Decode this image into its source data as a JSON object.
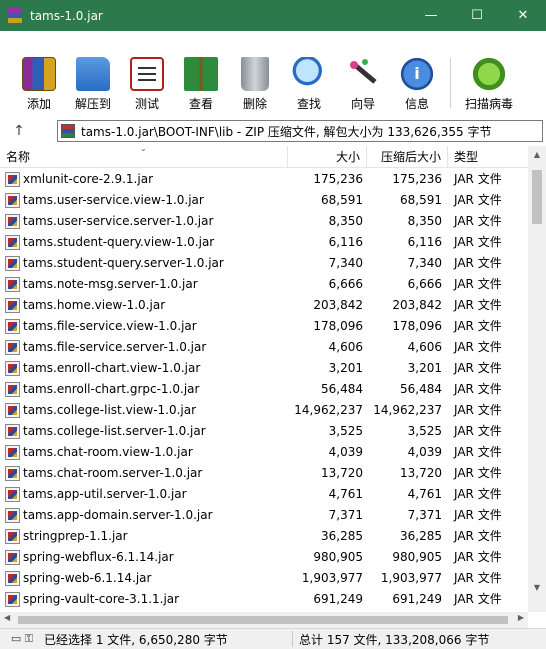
{
  "window": {
    "title": "tams-1.0.jar",
    "minimize": "—",
    "maximize": "☐",
    "close": "✕"
  },
  "toolbar": [
    {
      "label": "添加",
      "icon": "add-archive-icon"
    },
    {
      "label": "解压到",
      "icon": "extract-to-icon"
    },
    {
      "label": "测试",
      "icon": "test-icon"
    },
    {
      "label": "查看",
      "icon": "view-icon"
    },
    {
      "label": "删除",
      "icon": "delete-icon"
    },
    {
      "label": "查找",
      "icon": "find-icon"
    },
    {
      "label": "向导",
      "icon": "wizard-icon"
    },
    {
      "label": "信息",
      "icon": "info-icon"
    },
    {
      "label": "扫描病毒",
      "icon": "virus-scan-icon"
    }
  ],
  "address": {
    "up": "↑",
    "path": "tams-1.0.jar\\BOOT-INF\\lib - ZIP 压缩文件, 解包大小为 133,626,355 字节"
  },
  "columns": {
    "name": "名称",
    "size": "大小",
    "packed": "压缩后大小",
    "type": "类型"
  },
  "files": [
    {
      "name": "xmlunit-core-2.9.1.jar",
      "size": "175,236",
      "packed": "175,236",
      "type": "JAR 文件"
    },
    {
      "name": "tams.user-service.view-1.0.jar",
      "size": "68,591",
      "packed": "68,591",
      "type": "JAR 文件"
    },
    {
      "name": "tams.user-service.server-1.0.jar",
      "size": "8,350",
      "packed": "8,350",
      "type": "JAR 文件"
    },
    {
      "name": "tams.student-query.view-1.0.jar",
      "size": "6,116",
      "packed": "6,116",
      "type": "JAR 文件"
    },
    {
      "name": "tams.student-query.server-1.0.jar",
      "size": "7,340",
      "packed": "7,340",
      "type": "JAR 文件"
    },
    {
      "name": "tams.note-msg.server-1.0.jar",
      "size": "6,666",
      "packed": "6,666",
      "type": "JAR 文件"
    },
    {
      "name": "tams.home.view-1.0.jar",
      "size": "203,842",
      "packed": "203,842",
      "type": "JAR 文件"
    },
    {
      "name": "tams.file-service.view-1.0.jar",
      "size": "178,096",
      "packed": "178,096",
      "type": "JAR 文件"
    },
    {
      "name": "tams.file-service.server-1.0.jar",
      "size": "4,606",
      "packed": "4,606",
      "type": "JAR 文件"
    },
    {
      "name": "tams.enroll-chart.view-1.0.jar",
      "size": "3,201",
      "packed": "3,201",
      "type": "JAR 文件"
    },
    {
      "name": "tams.enroll-chart.grpc-1.0.jar",
      "size": "56,484",
      "packed": "56,484",
      "type": "JAR 文件"
    },
    {
      "name": "tams.college-list.view-1.0.jar",
      "size": "14,962,237",
      "packed": "14,962,237",
      "type": "JAR 文件"
    },
    {
      "name": "tams.college-list.server-1.0.jar",
      "size": "3,525",
      "packed": "3,525",
      "type": "JAR 文件"
    },
    {
      "name": "tams.chat-room.view-1.0.jar",
      "size": "4,039",
      "packed": "4,039",
      "type": "JAR 文件"
    },
    {
      "name": "tams.chat-room.server-1.0.jar",
      "size": "13,720",
      "packed": "13,720",
      "type": "JAR 文件"
    },
    {
      "name": "tams.app-util.server-1.0.jar",
      "size": "4,761",
      "packed": "4,761",
      "type": "JAR 文件"
    },
    {
      "name": "tams.app-domain.server-1.0.jar",
      "size": "7,371",
      "packed": "7,371",
      "type": "JAR 文件"
    },
    {
      "name": "stringprep-1.1.jar",
      "size": "36,285",
      "packed": "36,285",
      "type": "JAR 文件"
    },
    {
      "name": "spring-webflux-6.1.14.jar",
      "size": "980,905",
      "packed": "980,905",
      "type": "JAR 文件"
    },
    {
      "name": "spring-web-6.1.14.jar",
      "size": "1,903,977",
      "packed": "1,903,977",
      "type": "JAR 文件"
    },
    {
      "name": "spring-vault-core-3.1.1.jar",
      "size": "691,249",
      "packed": "691,249",
      "type": "JAR 文件"
    }
  ],
  "status": {
    "selected": "已经选择 1 文件, 6,650,280 字节",
    "total": "总计 157 文件, 133,208,066 字节"
  },
  "colors": {
    "titlebar": "#2c7a4b",
    "accent": "#0078d7"
  }
}
